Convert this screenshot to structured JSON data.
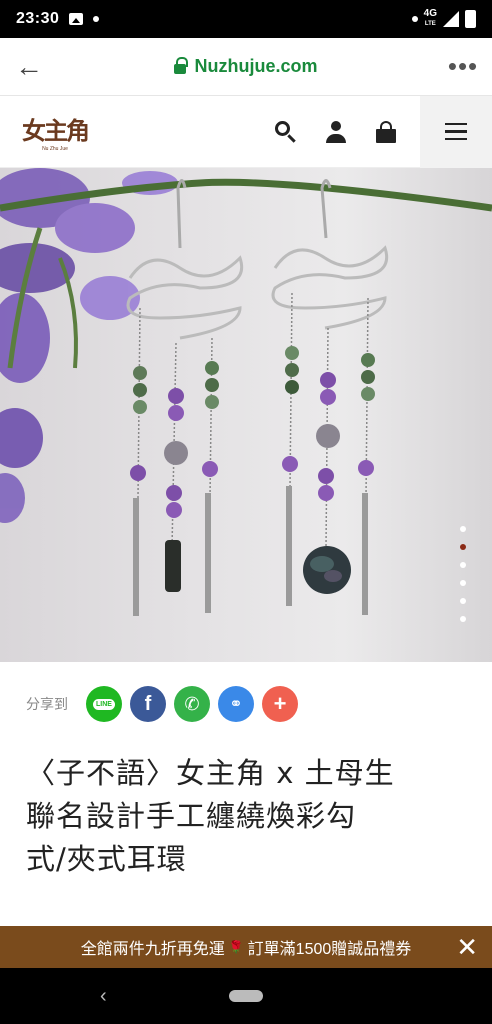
{
  "status_bar": {
    "time": "23:30",
    "network": "4G",
    "network_sub": "LTE"
  },
  "browser": {
    "url": "Nuzhujue.com"
  },
  "header": {
    "logo_text": "女主角",
    "logo_sub": "Nu Zhu Jue"
  },
  "carousel": {
    "total": 6,
    "active_index": 1
  },
  "share": {
    "label": "分享到",
    "buttons": [
      {
        "name": "line",
        "glyph": "LINE"
      },
      {
        "name": "facebook",
        "glyph": "f"
      },
      {
        "name": "whatsapp",
        "glyph": "✆"
      },
      {
        "name": "copy-link",
        "glyph": "⚭"
      },
      {
        "name": "more",
        "glyph": "+"
      }
    ]
  },
  "product": {
    "title_lines": [
      "〈子不語〉女主角 x 土母生",
      "聯名設計手工纏繞煥彩勾",
      "式/夾式耳環"
    ]
  },
  "promo": {
    "text_before": "全館兩件九折再免運",
    "text_after": "訂單滿1500贈誠品禮券",
    "close_glyph": "✕"
  },
  "colors": {
    "accent_brown": "#7a4b1c",
    "active_dot": "#8b2a16",
    "url_green": "#1a8a3c"
  }
}
